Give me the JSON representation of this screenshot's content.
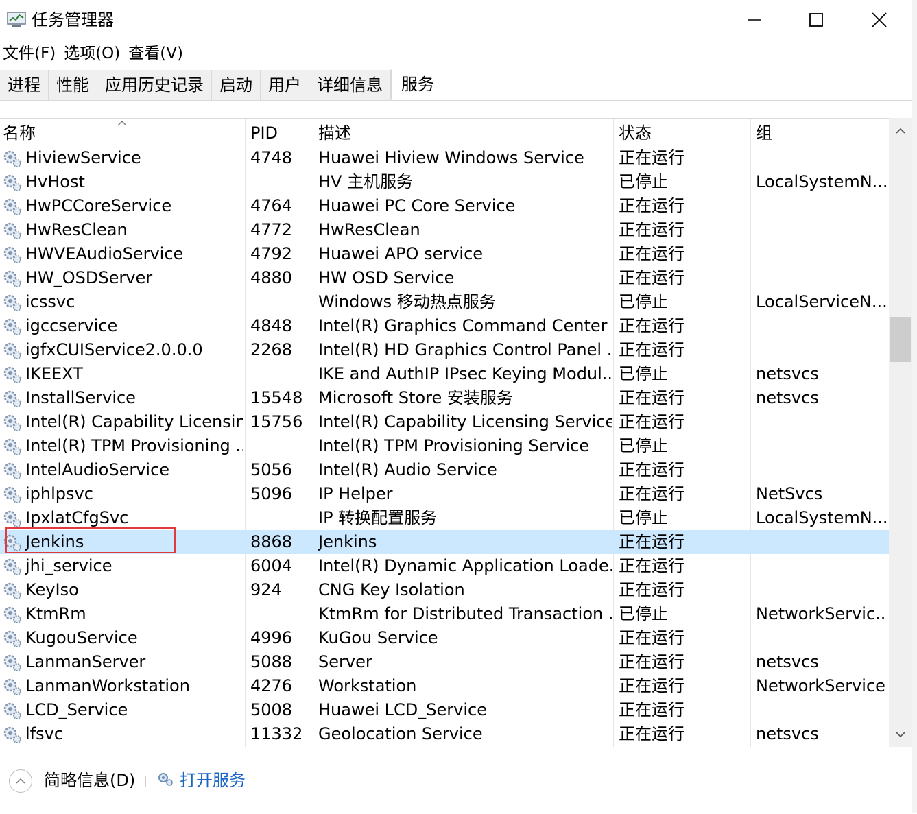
{
  "window": {
    "title": "任务管理器"
  },
  "menu": [
    "文件(F)",
    "选项(O)",
    "查看(V)"
  ],
  "tabs": [
    {
      "label": "进程",
      "active": false
    },
    {
      "label": "性能",
      "active": false
    },
    {
      "label": "应用历史记录",
      "active": false
    },
    {
      "label": "启动",
      "active": false
    },
    {
      "label": "用户",
      "active": false
    },
    {
      "label": "详细信息",
      "active": false
    },
    {
      "label": "服务",
      "active": true
    }
  ],
  "table": {
    "columns": [
      "名称",
      "PID",
      "描述",
      "状态",
      "组"
    ],
    "sorted_by": "名称",
    "selected_row": "Jenkins",
    "rows": [
      {
        "name": "HiviewService",
        "pid": "4748",
        "desc": "Huawei Hiview Windows Service",
        "status": "正在运行",
        "group": ""
      },
      {
        "name": "HvHost",
        "pid": "",
        "desc": "HV 主机服务",
        "status": "已停止",
        "group": "LocalSystemN..."
      },
      {
        "name": "HwPCCoreService",
        "pid": "4764",
        "desc": "Huawei PC Core Service",
        "status": "正在运行",
        "group": ""
      },
      {
        "name": "HwResClean",
        "pid": "4772",
        "desc": "HwResClean",
        "status": "正在运行",
        "group": ""
      },
      {
        "name": "HWVEAudioService",
        "pid": "4792",
        "desc": "Huawei APO service",
        "status": "正在运行",
        "group": ""
      },
      {
        "name": "HW_OSDServer",
        "pid": "4880",
        "desc": "HW OSD Service",
        "status": "正在运行",
        "group": ""
      },
      {
        "name": "icssvc",
        "pid": "",
        "desc": "Windows 移动热点服务",
        "status": "已停止",
        "group": "LocalServiceN..."
      },
      {
        "name": "igccservice",
        "pid": "4848",
        "desc": "Intel(R) Graphics Command Center ...",
        "status": "正在运行",
        "group": ""
      },
      {
        "name": "igfxCUIService2.0.0.0",
        "pid": "2268",
        "desc": "Intel(R) HD Graphics Control Panel ...",
        "status": "正在运行",
        "group": ""
      },
      {
        "name": "IKEEXT",
        "pid": "",
        "desc": "IKE and AuthIP IPsec Keying Modul...",
        "status": "已停止",
        "group": "netsvcs"
      },
      {
        "name": "InstallService",
        "pid": "15548",
        "desc": "Microsoft Store 安装服务",
        "status": "正在运行",
        "group": "netsvcs"
      },
      {
        "name": "Intel(R) Capability Licensin...",
        "pid": "15756",
        "desc": "Intel(R) Capability Licensing Service...",
        "status": "正在运行",
        "group": ""
      },
      {
        "name": "Intel(R) TPM Provisioning ...",
        "pid": "",
        "desc": "Intel(R) TPM Provisioning Service",
        "status": "已停止",
        "group": ""
      },
      {
        "name": "IntelAudioService",
        "pid": "5056",
        "desc": "Intel(R) Audio Service",
        "status": "正在运行",
        "group": ""
      },
      {
        "name": "iphlpsvc",
        "pid": "5096",
        "desc": "IP Helper",
        "status": "正在运行",
        "group": "NetSvcs"
      },
      {
        "name": "IpxlatCfgSvc",
        "pid": "",
        "desc": "IP 转换配置服务",
        "status": "已停止",
        "group": "LocalSystemN..."
      },
      {
        "name": "Jenkins",
        "pid": "8868",
        "desc": "Jenkins",
        "status": "正在运行",
        "group": ""
      },
      {
        "name": "jhi_service",
        "pid": "6004",
        "desc": "Intel(R) Dynamic Application Loade...",
        "status": "正在运行",
        "group": ""
      },
      {
        "name": "KeyIso",
        "pid": "924",
        "desc": "CNG Key Isolation",
        "status": "正在运行",
        "group": ""
      },
      {
        "name": "KtmRm",
        "pid": "",
        "desc": "KtmRm for Distributed Transaction ...",
        "status": "已停止",
        "group": "NetworkServic..."
      },
      {
        "name": "KugouService",
        "pid": "4996",
        "desc": "KuGou Service",
        "status": "正在运行",
        "group": ""
      },
      {
        "name": "LanmanServer",
        "pid": "5088",
        "desc": "Server",
        "status": "正在运行",
        "group": "netsvcs"
      },
      {
        "name": "LanmanWorkstation",
        "pid": "4276",
        "desc": "Workstation",
        "status": "正在运行",
        "group": "NetworkService"
      },
      {
        "name": "LCD_Service",
        "pid": "5008",
        "desc": "Huawei LCD_Service",
        "status": "正在运行",
        "group": ""
      },
      {
        "name": "lfsvc",
        "pid": "11332",
        "desc": "Geolocation Service",
        "status": "正在运行",
        "group": "netsvcs"
      }
    ]
  },
  "footer": {
    "brief": "简略信息(D)",
    "open_services": "打开服务"
  },
  "colors": {
    "selected_row": "#cce8ff",
    "highlight_box": "#e0393e",
    "link": "#1a66c7"
  },
  "icons": [
    "task-manager-icon",
    "minimize-icon",
    "maximize-icon",
    "close-icon",
    "sort-up-icon",
    "service-gear-icon",
    "scroll-up-icon",
    "scroll-down-icon",
    "chevron-up-icon"
  ]
}
